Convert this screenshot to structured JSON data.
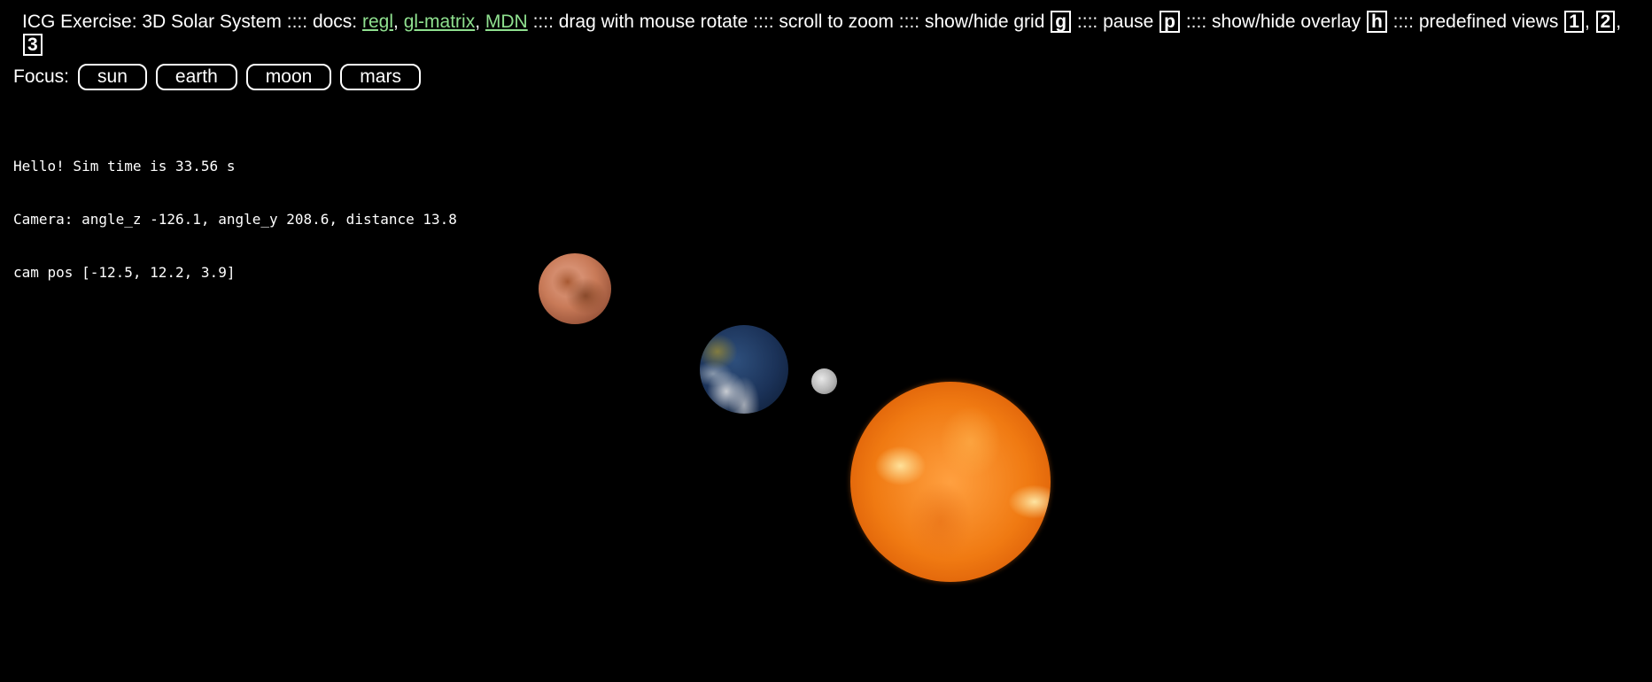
{
  "header": {
    "title": "ICG Exercise: 3D Solar System",
    "sep": "::::",
    "docs_label": "docs:",
    "links": [
      "regl",
      "gl-matrix",
      "MDN"
    ],
    "drag_text": "drag with mouse rotate",
    "scroll_text": "scroll to zoom",
    "grid_text": "show/hide grid",
    "grid_key": "g",
    "pause_text": "pause",
    "pause_key": "p",
    "overlay_text": "show/hide overlay",
    "overlay_key": "h",
    "views_text": "predefined views",
    "view_keys": [
      "1",
      "2",
      "3"
    ]
  },
  "focus": {
    "label": "Focus:",
    "buttons": [
      "sun",
      "earth",
      "moon",
      "mars"
    ]
  },
  "overlay": {
    "line1": "Hello! Sim time is 33.56 s",
    "line2": "Camera: angle_z -126.1, angle_y 208.6, distance 13.8",
    "line3": "cam pos [-12.5, 12.2, 3.9]"
  },
  "scene": {
    "bodies": [
      "mars",
      "earth",
      "moon",
      "sun"
    ],
    "colors": {
      "background": "#000000",
      "link": "#8fe08f",
      "sun": "#f07a12",
      "mars": "#c87a58",
      "earth": "#1b3258",
      "moon": "#b5b5b5"
    }
  }
}
